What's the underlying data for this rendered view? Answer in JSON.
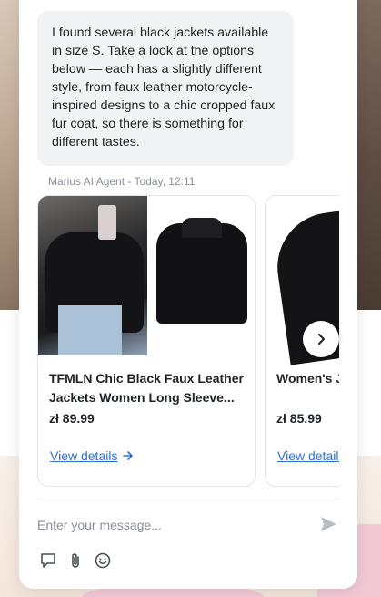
{
  "chat": {
    "message": "I found several black jackets available in size S. Take a look at the options below — each has a slightly different style, from faux leather motorcycle-inspired designs to a chic cropped faux fur coat, so there is something for different tastes.",
    "meta": "Marius AI Agent - Today, 12:11"
  },
  "products": [
    {
      "title": "TFMLN Chic Black Faux Leather Jackets Women Long Sleeve...",
      "price": "zł 89.99",
      "link_label": "View details"
    },
    {
      "title": "Women's J... Black Long...",
      "price": "zł 85.99",
      "link_label": "View details"
    }
  ],
  "composer": {
    "placeholder": "Enter your message..."
  },
  "icons": {
    "next": "chevron-right-icon",
    "send": "send-icon",
    "tools": [
      "feedback-icon",
      "paperclip-icon",
      "emoji-icon"
    ]
  },
  "colors": {
    "link": "#2f6fd6",
    "bubble_bg": "#f2f3f5",
    "meta_text": "#8a9099"
  }
}
